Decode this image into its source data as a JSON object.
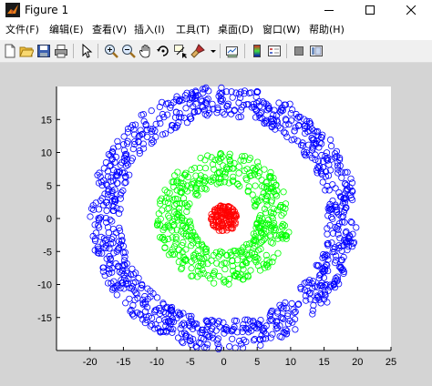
{
  "window": {
    "title": "Figure 1",
    "controls": [
      "minimize",
      "maximize",
      "close"
    ]
  },
  "menu": [
    {
      "label": "文件(F)"
    },
    {
      "label": "编辑(E)"
    },
    {
      "label": "查看(V)"
    },
    {
      "label": "插入(I)"
    },
    {
      "label": "工具(T)"
    },
    {
      "label": "桌面(D)"
    },
    {
      "label": "窗口(W)"
    },
    {
      "label": "帮助(H)"
    }
  ],
  "toolbar": {
    "icons": [
      "new-figure-icon",
      "open-file-icon",
      "save-icon",
      "print-icon",
      "edit-plot-arrow-icon",
      "zoom-in-icon",
      "zoom-out-icon",
      "pan-hand-icon",
      "rotate-3d-icon",
      "data-cursor-icon",
      "brush-icon",
      "link-plot-icon",
      "insert-colorbar-icon",
      "insert-legend-icon",
      "hide-plot-tools-icon",
      "show-plot-tools-icon"
    ]
  },
  "chart_data": {
    "type": "scatter",
    "title": "",
    "xlabel": "",
    "ylabel": "",
    "xlim": [
      -25,
      25
    ],
    "ylim": [
      -20,
      20
    ],
    "xticks": [
      -20,
      -15,
      -10,
      -5,
      0,
      5,
      10,
      15,
      20,
      25
    ],
    "yticks": [
      -15,
      -10,
      -5,
      0,
      5,
      10,
      15
    ],
    "marker": "circle-open",
    "grid": false,
    "series": [
      {
        "color": "#0000ff",
        "shape": "ring",
        "radius_min": 15.5,
        "radius_max": 20,
        "count": 1000
      },
      {
        "color": "#00ff00",
        "shape": "ring",
        "radius_min": 5,
        "radius_max": 10,
        "count": 500
      },
      {
        "color": "#ff0000",
        "shape": "disk",
        "radius_min": 0,
        "radius_max": 2,
        "count": 120
      }
    ]
  }
}
